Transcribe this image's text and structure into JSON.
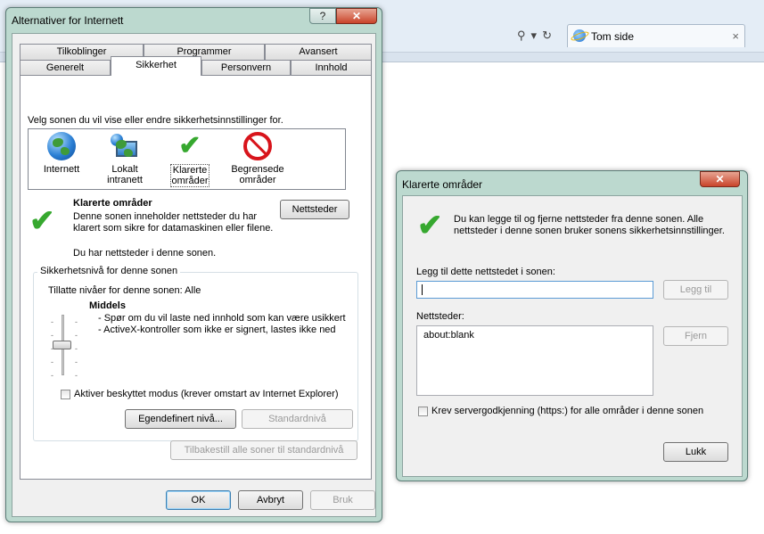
{
  "browser": {
    "tab_title": "Tom side",
    "tab_close": "×",
    "icons": [
      "search-icon",
      "dropdown-icon",
      "refresh-icon"
    ]
  },
  "main_dialog": {
    "title": "Alternativer for Internett",
    "help": "?",
    "close": "✕",
    "tabs_row1": [
      "Tilkoblinger",
      "Programmer",
      "Avansert"
    ],
    "tabs_row2": [
      "Generelt",
      "Sikkerhet",
      "Personvern",
      "Innhold"
    ],
    "active_tab": "Sikkerhet",
    "zone_prompt": "Velg sonen du vil vise eller endre sikkerhetsinnstillinger for.",
    "zones": [
      {
        "label": "Internett",
        "icon": "globe-icon"
      },
      {
        "label": "Lokalt intranett",
        "icon": "intranet-icon"
      },
      {
        "label": "Klarerte områder",
        "icon": "checkmark-icon"
      },
      {
        "label": "Begrensede områder",
        "icon": "restricted-icon"
      }
    ],
    "selected_zone_title": "Klarerte områder",
    "selected_zone_desc": "Denne sonen inneholder nettsteder du har klarert som sikre for datamaskinen eller filene.",
    "selected_zone_note": "Du har nettsteder i denne sonen.",
    "sites_button": "Nettsteder",
    "security_group_label": "Sikkerhetsnivå for denne sonen",
    "allowed_levels": "Tillatte nivåer for denne sonen: Alle",
    "level_name": "Middels",
    "level_desc_1": "- Spør om du vil laste ned innhold som kan være usikkert",
    "level_desc_2": "- ActiveX-kontroller som ikke er signert, lastes ikke ned",
    "protected_mode": "Aktiver beskyttet modus (krever omstart av Internet Explorer)",
    "custom_level": "Egendefinert nivå...",
    "default_level": "Standardnivå",
    "reset_all": "Tilbakestill alle soner til standardnivå",
    "ok": "OK",
    "cancel": "Avbryt",
    "apply": "Bruk"
  },
  "trusted_dialog": {
    "title": "Klarerte områder",
    "close": "✕",
    "info": "Du kan legge til og fjerne nettsteder fra denne sonen. Alle nettsteder i denne sonen bruker sonens sikkerhetsinnstillinger.",
    "add_label": "Legg til dette nettstedet i sonen:",
    "add_value": "",
    "add_button": "Legg til",
    "sites_label": "Nettsteder:",
    "sites": [
      "about:blank"
    ],
    "remove_button": "Fjern",
    "require_https": "Krev servergodkjenning (https:) for alle områder i denne sonen",
    "close_button": "Lukk"
  }
}
